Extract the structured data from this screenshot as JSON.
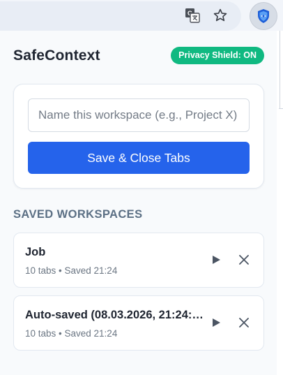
{
  "browser": {
    "icons": [
      "translate-icon",
      "star-icon",
      "extension-shield-icon"
    ]
  },
  "app": {
    "title": "SafeContext",
    "badge": "Privacy Shield: ON"
  },
  "save_form": {
    "input_value": "",
    "input_placeholder": "Name this workspace (e.g., Project X)",
    "button_label": "Save & Close Tabs"
  },
  "saved": {
    "heading": "SAVED WORKSPACES",
    "items": [
      {
        "name": "Job",
        "meta": "10 tabs • Saved 21:24"
      },
      {
        "name": "Auto-saved (08.03.2026, 21:24:…",
        "meta": "10 tabs • Saved 21:24"
      }
    ]
  },
  "colors": {
    "accent": "#2563eb",
    "badge_bg": "#10b981",
    "heading": "#5b6f84"
  }
}
